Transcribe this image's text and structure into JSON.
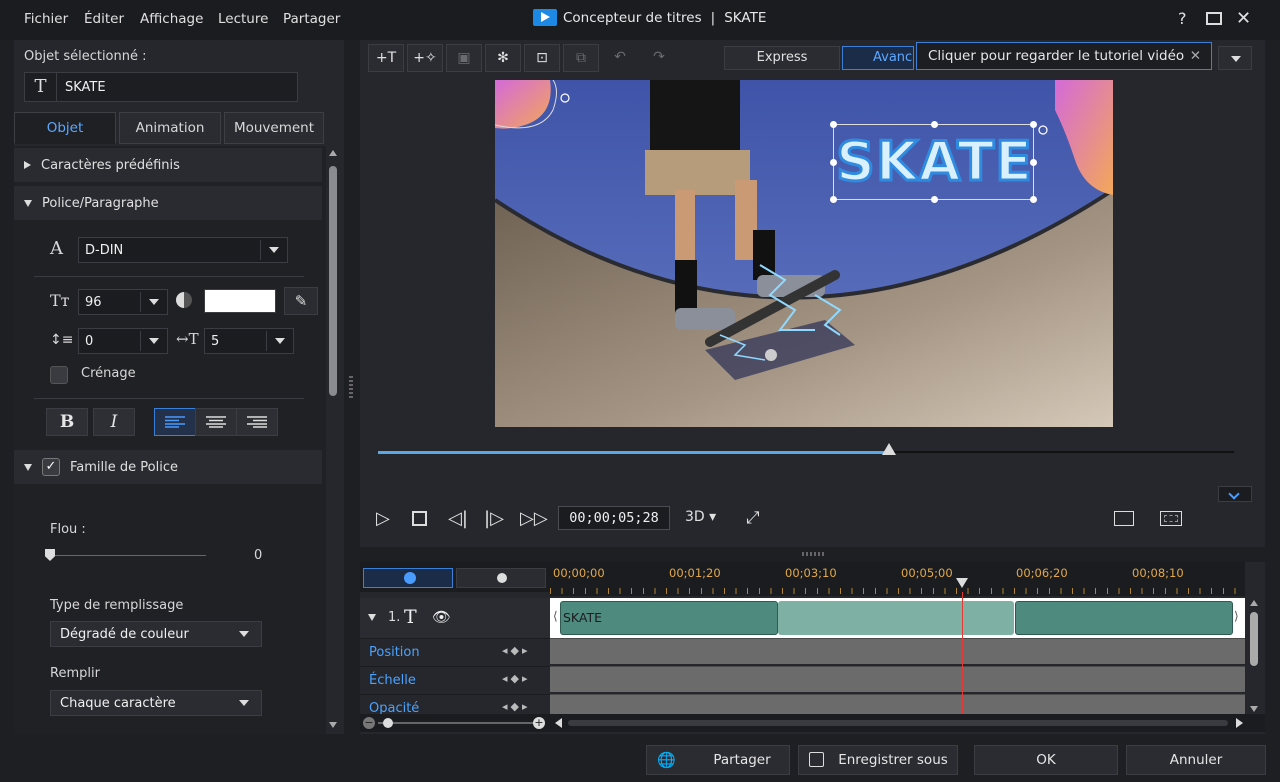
{
  "menu": [
    "Fichier",
    "Éditer",
    "Affichage",
    "Lecture",
    "Partager"
  ],
  "window": {
    "title": "Concepteur de titres",
    "separator": "|",
    "project": "SKATE",
    "help_icon": "question-mark-icon",
    "maximize_icon": "maximize-icon",
    "close_icon": "close-icon"
  },
  "left_panel": {
    "selected_label": "Objet sélectionné :",
    "selected_name": "SKATE",
    "tabs": [
      "Objet",
      "Animation",
      "Mouvement"
    ],
    "active_tab": "Objet",
    "sections": {
      "presets": "Caractères prédéfinis",
      "font_paragraph": "Police/Paragraphe",
      "font_family": "Famille de Police"
    },
    "font": {
      "name": "D-DIN",
      "size": "96",
      "color": "#ffffff",
      "line_spacing": "0",
      "char_spacing": "5",
      "kerning_label": "Crénage"
    },
    "format_buttons": {
      "bold": "B",
      "italic": "I"
    },
    "blur": {
      "label": "Flou :",
      "value": "0"
    },
    "fill_type": {
      "label": "Type de remplissage",
      "value": "Dégradé de couleur"
    },
    "fill": {
      "label": "Remplir",
      "value": "Chaque caractère"
    }
  },
  "preview": {
    "mode_tabs": {
      "express": "Express",
      "advanced": "Avancé"
    },
    "advanced_visible": "Avanc",
    "tooltip": "Cliquer pour regarder le tutoriel vidéo",
    "title_text": "SKATE",
    "progress": 0.597,
    "timecode": "00;00;05;28",
    "mode_3d": "3D"
  },
  "timeline": {
    "ruler_marks": [
      "00;00;00",
      "00;01;20",
      "00;03;10",
      "00;05;00",
      "00;06;20",
      "00;08;10"
    ],
    "track": {
      "index": "1.",
      "clip_name": "SKATE"
    },
    "keyframe_rows": [
      "Position",
      "Échelle",
      "Opacité"
    ],
    "playhead_position": 0.593
  },
  "footer": {
    "share": "Partager",
    "save_as": "Enregistrer sous",
    "ok": "OK",
    "cancel": "Annuler"
  },
  "colors": {
    "accent": "#4a9bff",
    "ruler_label": "#e0a84a",
    "playhead": "#e53935",
    "clip": "#4f8a7e"
  }
}
